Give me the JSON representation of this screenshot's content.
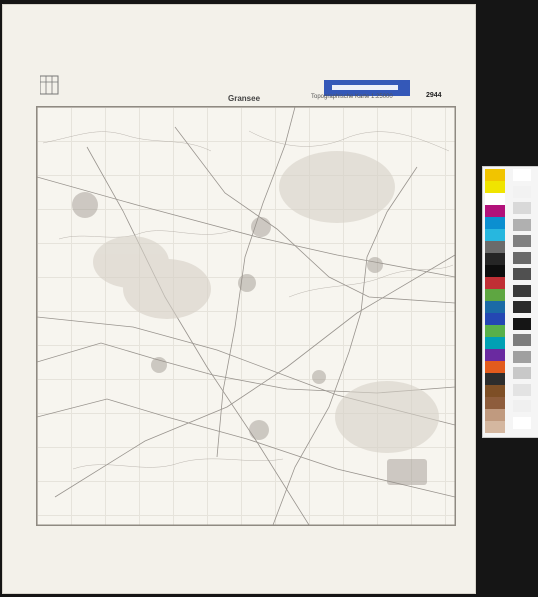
{
  "sheet": {
    "title": "Gransee",
    "subtitle": "Topographische Karte 1:25000",
    "sheet_number": "2944",
    "header_left": [
      "",
      "",
      ""
    ],
    "scale_note": "",
    "handwritten": [
      "",
      "",
      ""
    ]
  },
  "map": {
    "place_names": [
      "",
      "",
      "",
      "",
      "",
      "",
      "",
      "",
      "",
      ""
    ],
    "top_place": "",
    "mid_place": "",
    "left_place": ""
  },
  "calibration": {
    "colors": [
      "#f1c400",
      "#f0e400",
      "#ffffff",
      "#b2117a",
      "#0b8fd0",
      "#27b7df",
      "#6b6b6b",
      "#262626",
      "#0e0e0e",
      "#c02f35",
      "#5ea641",
      "#1b6aa6",
      "#2447b3",
      "#58b04a",
      "#00a0b4",
      "#6a2aa0",
      "#e25b1d",
      "#2d2d2d",
      "#7e4f26",
      "#8e5d3c",
      "#c09a7f",
      "#d4b7a0"
    ],
    "grays": [
      "#ffffff",
      "#f2f2f2",
      "#d9d9d9",
      "#b0b0b0",
      "#808080",
      "#6a6a6a",
      "#505050",
      "#3a3a3a",
      "#2a2a2a",
      "#151515",
      "#7c7c7c",
      "#a0a0a0",
      "#c8c8c8",
      "#e3e3e3",
      "#f0f0f0",
      "#ffffff"
    ]
  }
}
